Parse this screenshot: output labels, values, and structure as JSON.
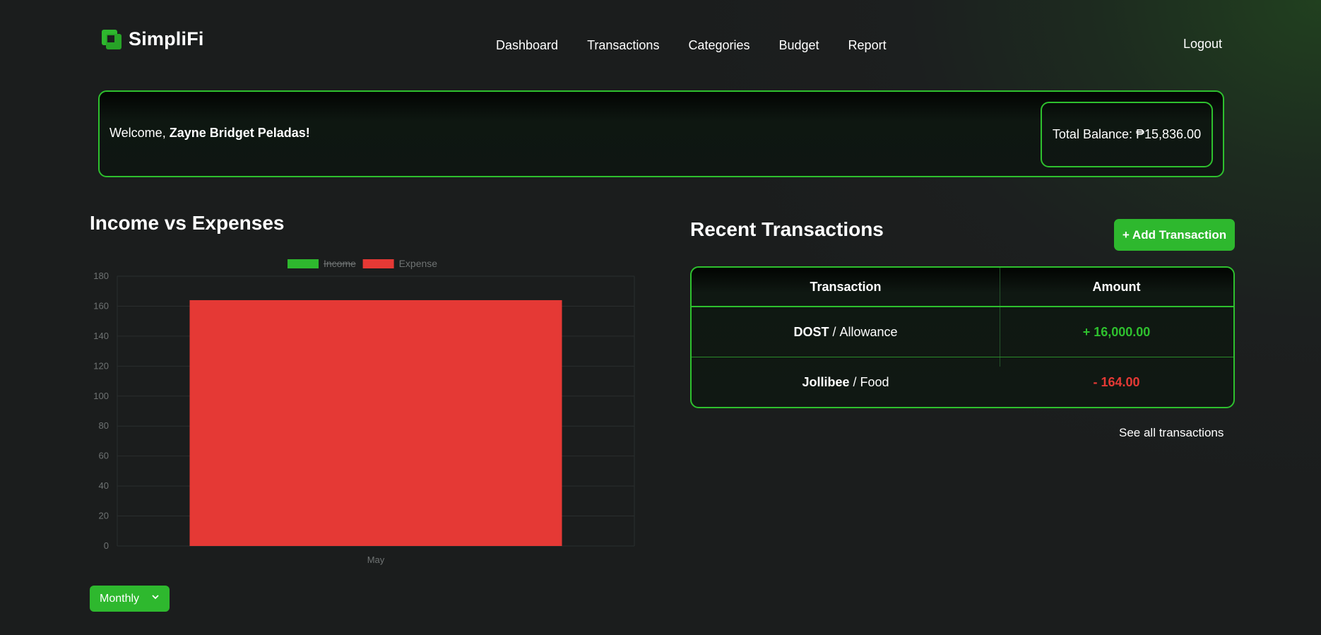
{
  "app": {
    "name": "SimpliFi",
    "logout": "Logout"
  },
  "nav": [
    "Dashboard",
    "Transactions",
    "Categories",
    "Budget",
    "Report"
  ],
  "welcome": {
    "prefix": "Welcome, ",
    "user": "Zayne Bridget Peladas!",
    "balance": "Total Balance: ₱15,836.00"
  },
  "chart_section": {
    "title": "Income vs Expenses",
    "period": "Monthly"
  },
  "chart_data": {
    "type": "bar",
    "categories": [
      "May"
    ],
    "series": [
      {
        "name": "Income",
        "values": [
          null
        ],
        "color": "#2eb82e",
        "hidden": true
      },
      {
        "name": "Expense",
        "values": [
          164
        ],
        "color": "#e53935"
      }
    ],
    "ylim": [
      0,
      180
    ],
    "yticks": [
      0,
      20,
      40,
      60,
      80,
      100,
      120,
      140,
      160,
      180
    ],
    "legend": "top-center",
    "grid": true
  },
  "transactions": {
    "title": "Recent Transactions",
    "add_label": "+ Add Transaction",
    "headers": [
      "Transaction",
      "Amount"
    ],
    "rows": [
      {
        "name": "DOST",
        "category": "Allowance",
        "amount": "+ 16,000.00",
        "type": "income"
      },
      {
        "name": "Jollibee",
        "category": "Food",
        "amount": "- 164.00",
        "type": "expense"
      }
    ],
    "see_all": "See all transactions"
  },
  "colors": {
    "accent": "#2eb82e",
    "expense": "#e53935"
  }
}
